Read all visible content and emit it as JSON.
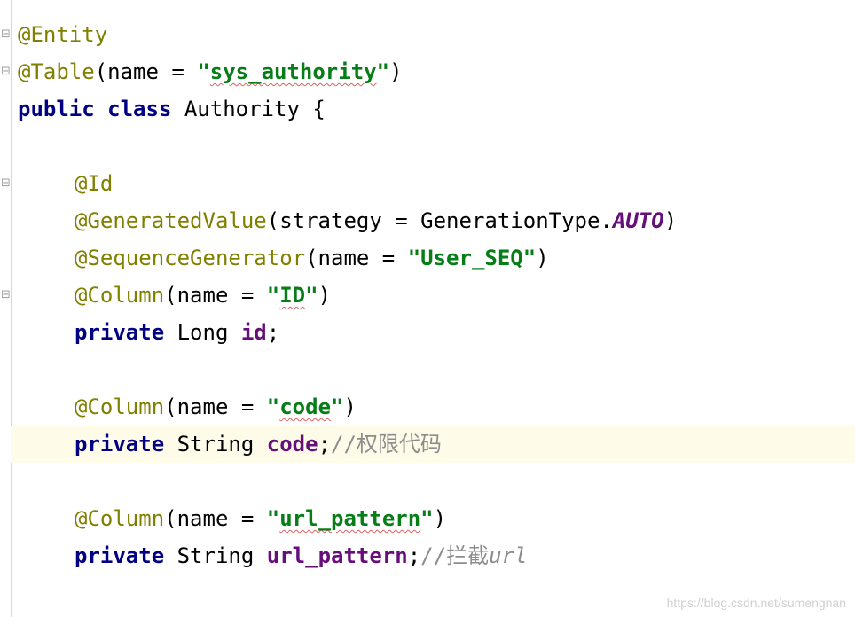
{
  "editor": {
    "lines": {
      "l1": {
        "annotation": "@Entity"
      },
      "l2": {
        "annotation": "@Table",
        "open": "(",
        "param": "name = ",
        "q1": "\"",
        "value": "sys_authority",
        "q2": "\"",
        "close": ")"
      },
      "l3": {
        "kw1": "public",
        "kw2": "class",
        "name": "Authority",
        "brace": "{"
      },
      "l5": {
        "annotation": "@Id"
      },
      "l6": {
        "annotation": "@GeneratedValue",
        "open": "(",
        "param": "strategy = GenerationType.",
        "constant": "AUTO",
        "close": ")"
      },
      "l7": {
        "annotation": "@SequenceGenerator",
        "open": "(",
        "param": "name = ",
        "value": "\"User_SEQ\"",
        "close": ")"
      },
      "l8": {
        "annotation": "@Column",
        "open": "(",
        "param": "name = ",
        "q1": "\"",
        "value": "ID",
        "q2": "\"",
        "close": ")"
      },
      "l9": {
        "kw": "private",
        "type": "Long",
        "field": "id",
        "semi": ";"
      },
      "l11": {
        "annotation": "@Column",
        "open": "(",
        "param": "name = ",
        "q1": "\"",
        "value": "code",
        "q2": "\"",
        "close": ")"
      },
      "l12": {
        "kw": "private",
        "type": "String",
        "field": "code",
        "semi": ";",
        "comment": "//权限代码"
      },
      "l14": {
        "annotation": "@Column",
        "open": "(",
        "param": "name = ",
        "q1": "\"",
        "value": "url_pattern",
        "q2": "\"",
        "close": ")"
      },
      "l15": {
        "kw": "private",
        "type": "String",
        "field": "url_pattern",
        "semi": ";",
        "comment": "//拦截",
        "comment_tail": "url"
      }
    }
  },
  "watermark": "https://blog.csdn.net/sumengnan",
  "colors": {
    "annotation": "#808000",
    "keyword": "#000080",
    "string": "#067d17",
    "field": "#660e7a",
    "comment": "#8c8c8c",
    "current_line": "#fefbe8"
  }
}
